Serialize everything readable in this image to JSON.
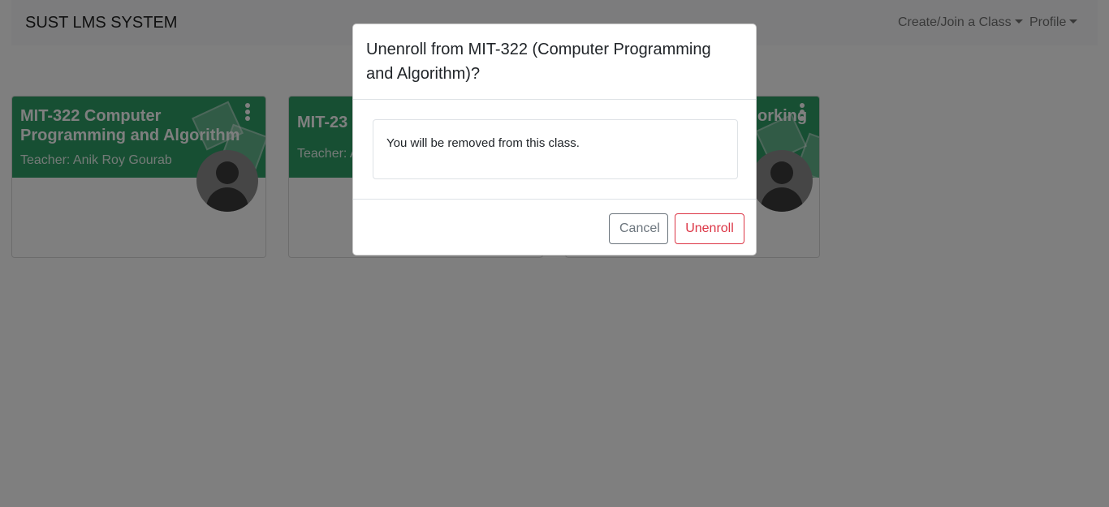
{
  "navbar": {
    "brand": "SUST LMS SYSTEM",
    "create_join": "Create/Join a Class",
    "profile": "Profile"
  },
  "cards": [
    {
      "title": "MIT-322 Computer Programming and Algorithm",
      "teacher": "Teacher: Anik Roy Gourab"
    },
    {
      "title": "MIT-23",
      "teacher": "Teacher: A"
    },
    {
      "title": "orking",
      "teacher": ""
    }
  ],
  "modal": {
    "title": "Unenroll from MIT-322 (Computer Programming and Algorithm)?",
    "body": "You will be removed from this class.",
    "cancel_label": "Cancel",
    "unenroll_label": "Unenroll"
  },
  "colors": {
    "banner": "#2f9e67",
    "danger": "#dc3545",
    "secondary": "#6c757d"
  },
  "icons": {
    "kebab": "more-vertical-icon",
    "avatar": "user-avatar-icon"
  }
}
